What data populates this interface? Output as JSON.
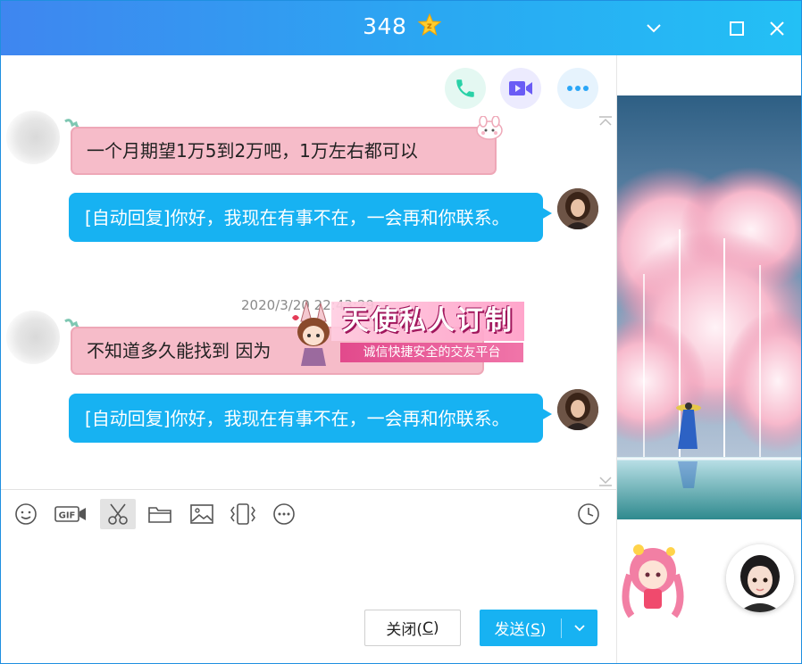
{
  "window": {
    "title": "348",
    "vip_badge": "z",
    "controls": {
      "dropdown": "chevron-down-icon",
      "maximize": "maximize-icon",
      "close": "close-icon"
    }
  },
  "call_actions": [
    {
      "name": "voice-call",
      "icon": "phone-icon",
      "color": "#2ad1a7"
    },
    {
      "name": "video-call",
      "icon": "video-camera-icon",
      "color": "#6a5cf5"
    },
    {
      "name": "more",
      "icon": "more-dots-icon",
      "color": "#2aa6f7"
    }
  ],
  "messages": [
    {
      "side": "left",
      "type": "pink",
      "text": "一个月期望1万5到2万吧，1万左右都可以"
    },
    {
      "side": "right",
      "type": "blue",
      "text": "[自动回复]你好，我现在有事不在，一会再和你联系。"
    },
    {
      "side": "center",
      "type": "timestamp",
      "text": "2020/3/20 22:43:29"
    },
    {
      "side": "left",
      "type": "pink",
      "text": "不知道多久能找到 因为"
    },
    {
      "side": "right",
      "type": "blue",
      "text": "[自动回复]你好，我现在有事不在，一会再和你联系。"
    }
  ],
  "watermark": {
    "title": "天使私人订制",
    "subtitle": "诚信快捷安全的交友平台"
  },
  "toolbar": [
    {
      "name": "emoji",
      "icon": "smiley-icon",
      "active": false
    },
    {
      "name": "gif",
      "icon": "gif-icon",
      "active": false
    },
    {
      "name": "screenshot",
      "icon": "scissors-icon",
      "active": true
    },
    {
      "name": "file",
      "icon": "folder-icon",
      "active": false
    },
    {
      "name": "image",
      "icon": "image-icon",
      "active": false
    },
    {
      "name": "shake",
      "icon": "vibrate-icon",
      "active": false
    },
    {
      "name": "more",
      "icon": "more-circle-icon",
      "active": false
    },
    {
      "name": "history",
      "icon": "clock-icon",
      "active": false
    }
  ],
  "input": {
    "value": "",
    "placeholder": ""
  },
  "buttons": {
    "close_label": "关闭(",
    "close_key": "C",
    "close_suffix": ")",
    "send_label": "发送(",
    "send_key": "S",
    "send_suffix": ")"
  },
  "colors": {
    "accent": "#17b2f2",
    "pink_bubble": "#f6bcc9",
    "title_start": "#3f86f0",
    "title_end": "#23c0f5"
  }
}
